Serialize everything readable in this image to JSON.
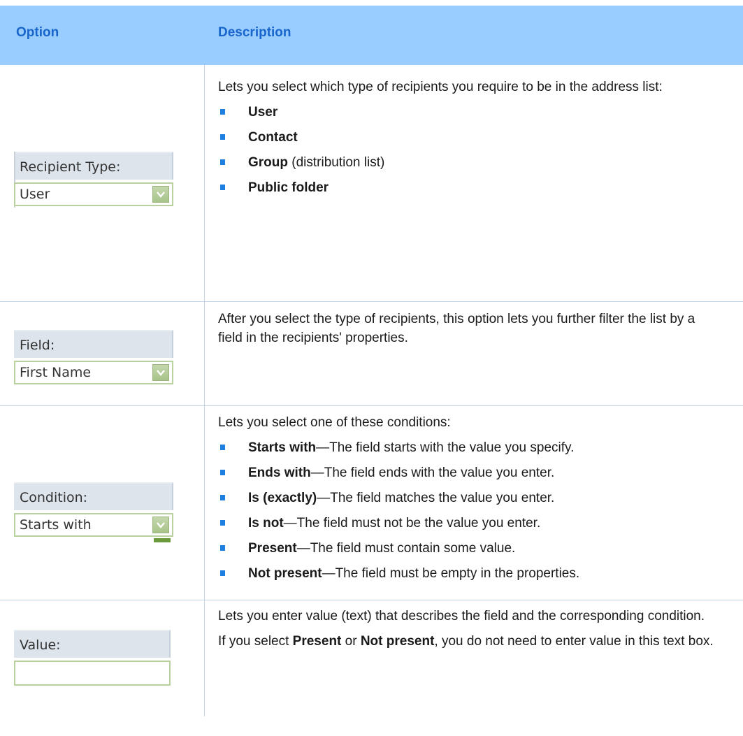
{
  "header": {
    "option": "Option",
    "description": "Description"
  },
  "rows": [
    {
      "widget": {
        "label": "Recipient Type:",
        "value": "User",
        "icon": "dropdown-arrow-icon"
      },
      "intro": "Lets you select which type of recipients you require to be in the address list:",
      "items": [
        {
          "bold": "User",
          "rest": ""
        },
        {
          "bold": "Contact",
          "rest": ""
        },
        {
          "bold": "Group",
          "rest": " (distribution list)"
        },
        {
          "bold": "Public folder",
          "rest": ""
        }
      ]
    },
    {
      "widget": {
        "label": "Field:",
        "value": "First Name",
        "icon": "dropdown-arrow-icon"
      },
      "intro": "After you select the type of recipients, this option lets you further filter the list by a field in the recipients' properties."
    },
    {
      "widget": {
        "label": "Condition:",
        "value": "Starts with",
        "icon": "dropdown-arrow-icon"
      },
      "intro": "Lets you select one of these conditions:",
      "items": [
        {
          "bold": "Starts with",
          "rest": "—The field starts with the value you specify."
        },
        {
          "bold": "Ends with",
          "rest": "—The field ends with the value you enter."
        },
        {
          "bold": "Is (exactly)",
          "rest": "—The field matches the value you enter."
        },
        {
          "bold": "Is not",
          "rest": "—The field must not be the value you enter."
        },
        {
          "bold": "Present",
          "rest": "—The field must contain some value."
        },
        {
          "bold": "Not present",
          "rest": "—The field must be empty in the properties."
        }
      ]
    },
    {
      "widget": {
        "label": "Value:",
        "value": ""
      },
      "intro": "Lets you enter value (text) that describes the field and the corresponding condition.",
      "note": {
        "pre": "If you select ",
        "b1": "Present",
        "mid": " or ",
        "b2": "Not present",
        "post": ", you do not need to enter value in this text box."
      }
    }
  ]
}
